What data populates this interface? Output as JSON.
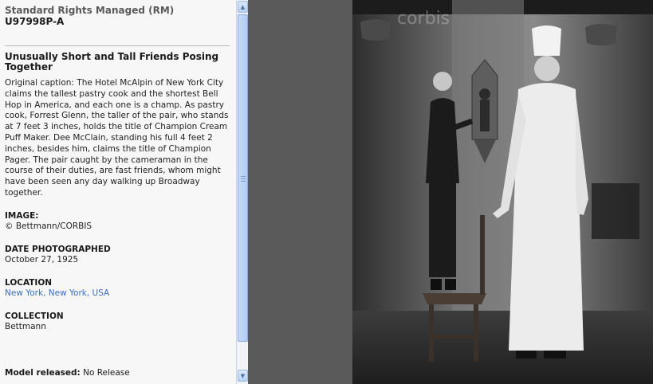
{
  "license": "Standard Rights Managed (RM)",
  "image_id": "U97998P-A",
  "title": "Unusually Short and Tall Friends Posing Together",
  "caption": "Original caption: The Hotel McAlpin of New York City claims the tallest pastry cook and the shortest Bell Hop in America, and each one is a champ. As pastry cook, Forrest Glenn, the taller of the pair, who stands at 7 feet 3 inches, holds the title of Champion Cream Puff Maker. Dee McClain, standing his full 4 feet 2 inches, besides him, claims the title of Champion Pager. The pair caught by the cameraman in the course of their duties, are fast friends, whom might have been seen any day walking up Broadway together.",
  "fields": {
    "image_label": "IMAGE:",
    "image_value": "© Bettmann/CORBIS",
    "date_label": "DATE PHOTOGRAPHED",
    "date_value": "October 27, 1925",
    "location_label": "LOCATION",
    "location_value": "New York, New York, USA",
    "collection_label": "COLLECTION",
    "collection_value": "Bettmann"
  },
  "model_release_label": "Model released:",
  "model_release_value": "No Release",
  "watermark": "corbis",
  "icons": {
    "scroll_up": "▲",
    "scroll_down": "▼"
  },
  "colors": {
    "link": "#3a6ec2",
    "viewer_bg": "#5a5a5a"
  }
}
